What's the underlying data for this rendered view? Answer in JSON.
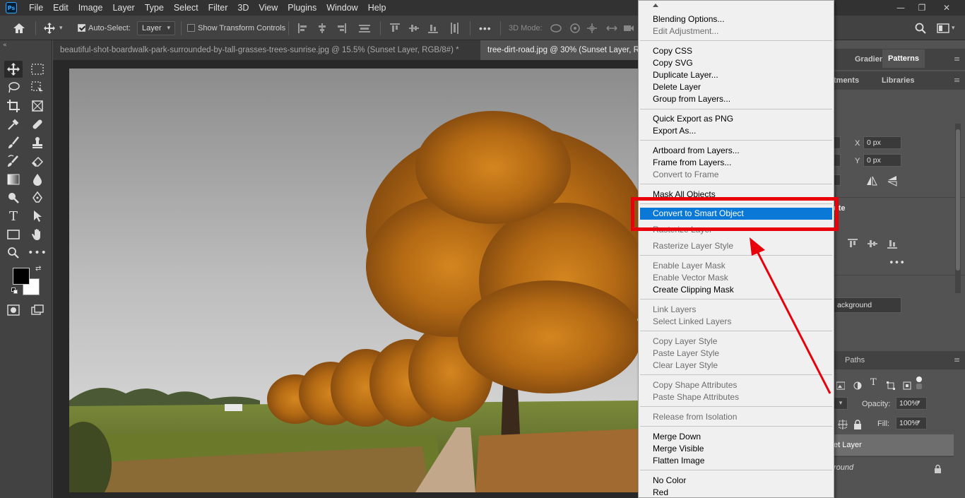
{
  "app": {
    "logo": "Ps",
    "menus": [
      "File",
      "Edit",
      "Image",
      "Layer",
      "Type",
      "Select",
      "Filter",
      "3D",
      "View",
      "Plugins",
      "Window",
      "Help"
    ]
  },
  "options_bar": {
    "auto_select_label": "Auto-Select:",
    "auto_select_checked": true,
    "auto_select_target": "Layer",
    "show_transform_label": "Show Transform Controls",
    "show_transform_checked": false,
    "more_label": "•••",
    "mode_3d_label": "3D Mode:"
  },
  "document_tabs": [
    {
      "label": "beautiful-shot-boardwalk-park-surrounded-by-tall-grasses-trees-sunrise.jpg @ 15.5% (Sunset Layer, RGB/8#) *",
      "active": false
    },
    {
      "label": "tree-dirt-road.jpg @ 30% (Sunset Layer, R",
      "active": true
    }
  ],
  "right_panel": {
    "top_tabs": [
      "Gradients",
      "Patterns"
    ],
    "active_top_tab": "Patterns",
    "second_tabs": [
      "tments",
      "Libraries"
    ],
    "x_label": "X",
    "x_value": "0 px",
    "y_label": "Y",
    "y_value": "0 px",
    "section_label": "ute",
    "more_label": "•••",
    "background_field": "ackground",
    "layers_tab": "Paths",
    "opacity_label": "Opacity:",
    "opacity_value": "100%",
    "fill_label": "Fill:",
    "fill_value": "100%",
    "layers": [
      {
        "name": "et Layer",
        "selected": true
      },
      {
        "name": "round",
        "italic": true,
        "locked": true
      }
    ]
  },
  "context_menu": {
    "groups": [
      [
        {
          "label": "Blending Options...",
          "enabled": true
        },
        {
          "label": "Edit Adjustment...",
          "enabled": false
        }
      ],
      [
        {
          "label": "Copy CSS",
          "enabled": true
        },
        {
          "label": "Copy SVG",
          "enabled": true
        },
        {
          "label": "Duplicate Layer...",
          "enabled": true
        },
        {
          "label": "Delete Layer",
          "enabled": true
        },
        {
          "label": "Group from Layers...",
          "enabled": true
        }
      ],
      [
        {
          "label": "Quick Export as PNG",
          "enabled": true
        },
        {
          "label": "Export As...",
          "enabled": true
        }
      ],
      [
        {
          "label": "Artboard from Layers...",
          "enabled": true
        },
        {
          "label": "Frame from Layers...",
          "enabled": true
        },
        {
          "label": "Convert to Frame",
          "enabled": false
        }
      ],
      [
        {
          "label": "Mask All Objects",
          "enabled": true
        },
        {
          "label": "Convert to Smart Object",
          "enabled": true,
          "highlighted": true
        }
      ],
      [
        {
          "label": "Rasterize Layer",
          "enabled": false
        },
        {
          "label": "Rasterize Layer Style",
          "enabled": false
        }
      ],
      [
        {
          "label": "Enable Layer Mask",
          "enabled": false
        },
        {
          "label": "Enable Vector Mask",
          "enabled": false
        },
        {
          "label": "Create Clipping Mask",
          "enabled": true
        }
      ],
      [
        {
          "label": "Link Layers",
          "enabled": false
        },
        {
          "label": "Select Linked Layers",
          "enabled": false
        }
      ],
      [
        {
          "label": "Copy Layer Style",
          "enabled": false
        },
        {
          "label": "Paste Layer Style",
          "enabled": false
        },
        {
          "label": "Clear Layer Style",
          "enabled": false
        }
      ],
      [
        {
          "label": "Copy Shape Attributes",
          "enabled": false
        },
        {
          "label": "Paste Shape Attributes",
          "enabled": false
        }
      ],
      [
        {
          "label": "Release from Isolation",
          "enabled": false
        }
      ],
      [
        {
          "label": "Merge Down",
          "enabled": true
        },
        {
          "label": "Merge Visible",
          "enabled": true
        },
        {
          "label": "Flatten Image",
          "enabled": true
        }
      ],
      [
        {
          "label": "No Color",
          "enabled": true
        },
        {
          "label": "Red",
          "enabled": true
        }
      ]
    ]
  },
  "colors": {
    "highlight": "#0a78d7",
    "annotation": "#e8000b",
    "foreground_swatch": "#000000",
    "background_swatch": "#ffffff"
  }
}
